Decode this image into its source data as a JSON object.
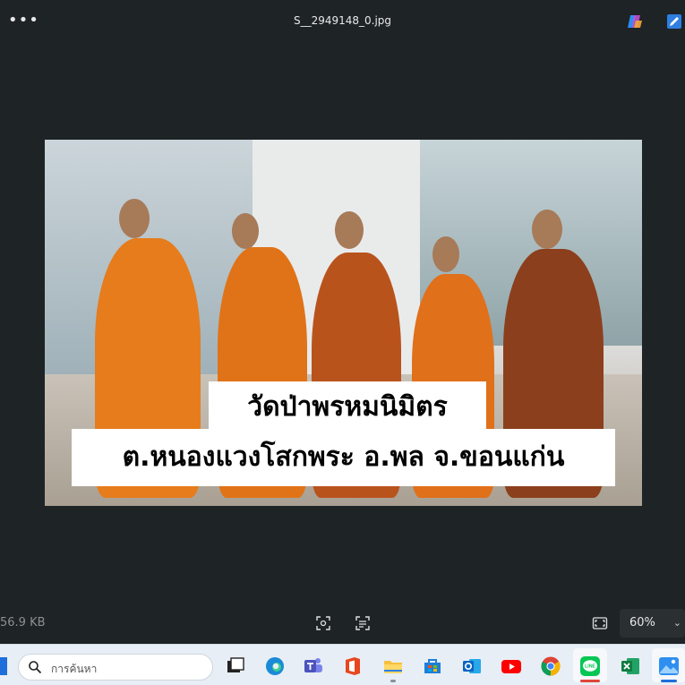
{
  "window": {
    "title": "S__2949148_0.jpg",
    "more_label": "•••",
    "icons": [
      "more-icon",
      "copilot-icon",
      "edit-icon"
    ]
  },
  "image": {
    "caption_line1": "วัดป่าพรหมนิมิตร",
    "caption_line2": "ต.หนองแวงโสกพระ อ.พล จ.ขอนแก่น"
  },
  "statusbar": {
    "file_size": "56.9 KB",
    "zoom": "60%",
    "tools": [
      "object-select-icon",
      "text-select-icon",
      "fit-screen-icon"
    ]
  },
  "taskbar": {
    "search_placeholder": "การค้นหา",
    "apps": [
      "task-view",
      "edge",
      "teams",
      "office",
      "file-explorer",
      "store",
      "outlook",
      "youtube",
      "chrome",
      "line",
      "excel",
      "photos"
    ]
  },
  "colors": {
    "app_bg": "#1e2326",
    "taskbar_bg": "#e8eef5",
    "caption_bg": "#ffffff",
    "caption_text": "#000000",
    "robe": "#e0761a",
    "active_indicator": "#e0453a"
  }
}
